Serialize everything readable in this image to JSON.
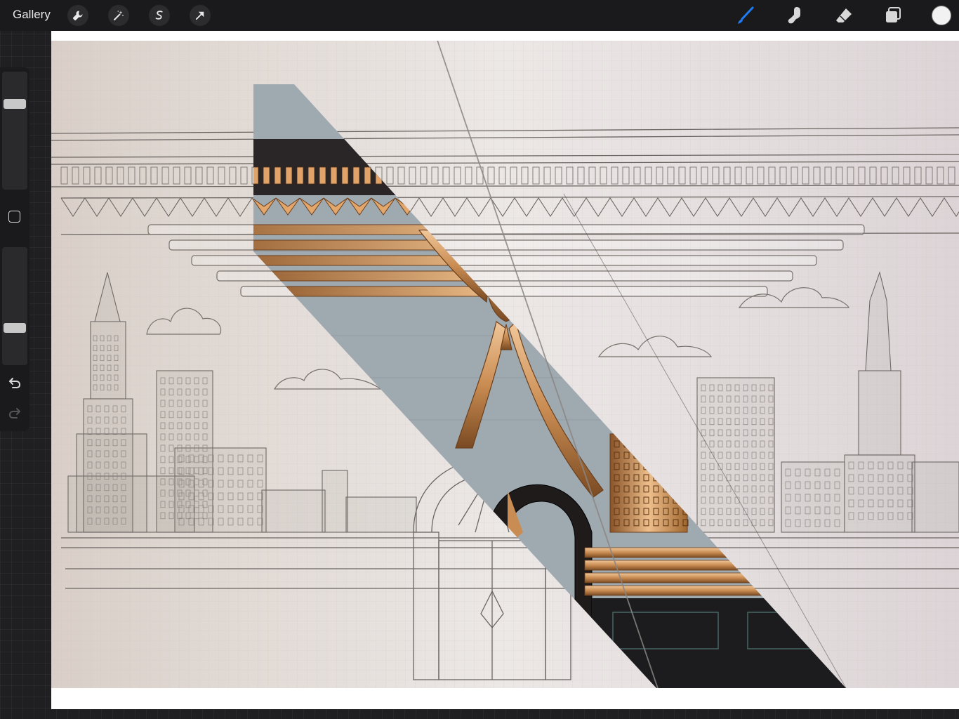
{
  "topbar": {
    "gallery_label": "Gallery",
    "left_tools": [
      {
        "name": "actions",
        "icon": "wrench-icon"
      },
      {
        "name": "adjustments",
        "icon": "magic-wand-icon"
      },
      {
        "name": "selection",
        "icon": "selection-s-icon"
      },
      {
        "name": "transform",
        "icon": "transform-arrow-icon"
      }
    ],
    "right_tools": [
      {
        "name": "brush",
        "icon": "brush-icon",
        "active": true
      },
      {
        "name": "smudge",
        "icon": "smudge-icon"
      },
      {
        "name": "eraser",
        "icon": "eraser-icon"
      },
      {
        "name": "layers",
        "icon": "layers-icon"
      }
    ],
    "current_color": "#f2f2f2",
    "accent_color": "#1e7cf0"
  },
  "sidebar": {
    "brush_size": 0.75,
    "brush_opacity": 0.3,
    "icons": [
      "modify-square-icon",
      "undo-icon",
      "redo-icon"
    ]
  }
}
